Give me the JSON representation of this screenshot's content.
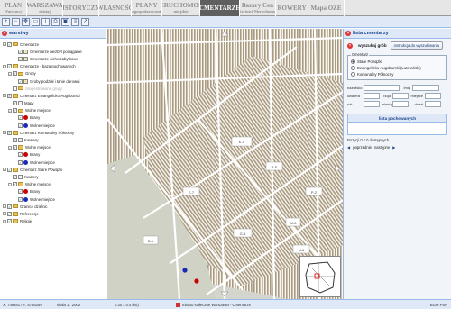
{
  "topnav": {
    "tabs": [
      {
        "l1": "PLAN",
        "l2": "Warszawy",
        "w": 30
      },
      {
        "l1": "WARSZAWA",
        "l2": "dzisiaj",
        "w": 40
      },
      {
        "l1": "HISTORYCZNA",
        "l2": "",
        "w": 40
      },
      {
        "l1": "WŁASNOŚĆ",
        "l2": "",
        "w": 36
      },
      {
        "l1": "PLANY",
        "l2": "zagospodarowania",
        "w": 34
      },
      {
        "l1": "NIERUCHOMOŚCI",
        "l2": "miejskie",
        "w": 42
      },
      {
        "l1": "CMENTARZE",
        "l2": "",
        "w": 44,
        "active": true
      },
      {
        "l1": "Bazary Cen",
        "l2": "i Wartości Nieruchomości",
        "w": 40
      },
      {
        "l1": "ROWERY",
        "l2": "",
        "w": 36
      },
      {
        "l1": "Mapa OZE",
        "l2": "",
        "w": 40
      }
    ]
  },
  "toolbar": {
    "icons": [
      "zoom-in-icon",
      "zoom-out-icon",
      "pan-icon",
      "measure-icon",
      "info-icon",
      "print-icon",
      "extent-icon",
      "layers-icon",
      "chart-icon"
    ],
    "glyphs": [
      "+",
      "−",
      "✥",
      "▭",
      "i",
      "⎙",
      "▣",
      "≡",
      "↗"
    ]
  },
  "layers": {
    "title": "warstwy",
    "rows": [
      {
        "indent": 0,
        "type": "group",
        "label": "Cmentarze"
      },
      {
        "indent": 2,
        "type": "item",
        "label": "Cmentarze niezbyt pociąganie"
      },
      {
        "indent": 2,
        "type": "item",
        "label": "Cmentarze ciche/zabytkowe"
      },
      {
        "indent": 0,
        "type": "group",
        "label": "Cmentarze - baza pochowanych"
      },
      {
        "indent": 1,
        "type": "group",
        "label": "Groby"
      },
      {
        "indent": 2,
        "type": "item",
        "label": "Groby podział i tanie darowni"
      },
      {
        "indent": 1,
        "type": "grey",
        "label": "zarejestrowane grupy"
      },
      {
        "indent": 0,
        "type": "group",
        "label": "Cmentarz Ewangelicko-Augsburski"
      },
      {
        "indent": 1,
        "type": "leg",
        "color": "#f3f3f3",
        "label": "Mapy"
      },
      {
        "indent": 1,
        "type": "group",
        "label": "Wolne miejsce"
      },
      {
        "indent": 2,
        "type": "dot",
        "color": "#cc0000",
        "label": "Brany"
      },
      {
        "indent": 2,
        "type": "dot",
        "color": "#1a2bb8",
        "label": "Wolne miejsce"
      },
      {
        "indent": 0,
        "type": "group",
        "label": "Cmentarz Komunalny Północny"
      },
      {
        "indent": 1,
        "type": "leg",
        "color": "#f3f3f3",
        "label": "Kwatery"
      },
      {
        "indent": 1,
        "type": "group",
        "label": "Wolne miejsce"
      },
      {
        "indent": 2,
        "type": "dot",
        "color": "#cc0000",
        "label": "Brany"
      },
      {
        "indent": 2,
        "type": "dot",
        "color": "#1a2bb8",
        "label": "Wolne miejsce"
      },
      {
        "indent": 0,
        "type": "group",
        "label": "Cmentarz Stare Powązki"
      },
      {
        "indent": 1,
        "type": "leg",
        "color": "#f3f3f3",
        "label": "Kwatery"
      },
      {
        "indent": 1,
        "type": "group",
        "label": "Wolne miejsce"
      },
      {
        "indent": 2,
        "type": "dot",
        "color": "#cc0000",
        "label": "Brany"
      },
      {
        "indent": 2,
        "type": "dot",
        "color": "#1a2bb8",
        "label": "Wolne miejsce"
      },
      {
        "indent": 0,
        "type": "group",
        "label": "Granice dzielnic"
      },
      {
        "indent": 0,
        "type": "group",
        "label": "Referencje"
      },
      {
        "indent": 0,
        "type": "group",
        "label": "Religie"
      }
    ]
  },
  "right": {
    "title": "lista cmentarzy",
    "search_btn": "wyszukaj grób",
    "instr_link": "instrukcja do wyszukiwania",
    "fieldset_label": "Cmentarz",
    "options": [
      "Stare Powązki",
      "Ewangelicko-Augsburski (Luterański)",
      "Komunalny Północny"
    ],
    "selected": 0,
    "fields": {
      "nazwisko": "nazwisko",
      "imie": "imię",
      "kwatera": "kwatera",
      "rzad": "rząd",
      "miejsce": "miejsce",
      "rok": "rok",
      "miesiac": "miesiąc",
      "dzien": "dzień"
    },
    "results_title": "lista pochowanych",
    "results_info": "Pozycji 0 z 0 dostępnych",
    "prev": "poprzednie",
    "next": "następne"
  },
  "status": {
    "coords": "X: 7492817 Y: 5758259",
    "scale": "skala 1 : 2000",
    "size": "0.30 x 0.4 (ko)",
    "legend_text": "miasto stołeczne Warszawa - Cmentarze",
    "right": "BGM PSP"
  }
}
